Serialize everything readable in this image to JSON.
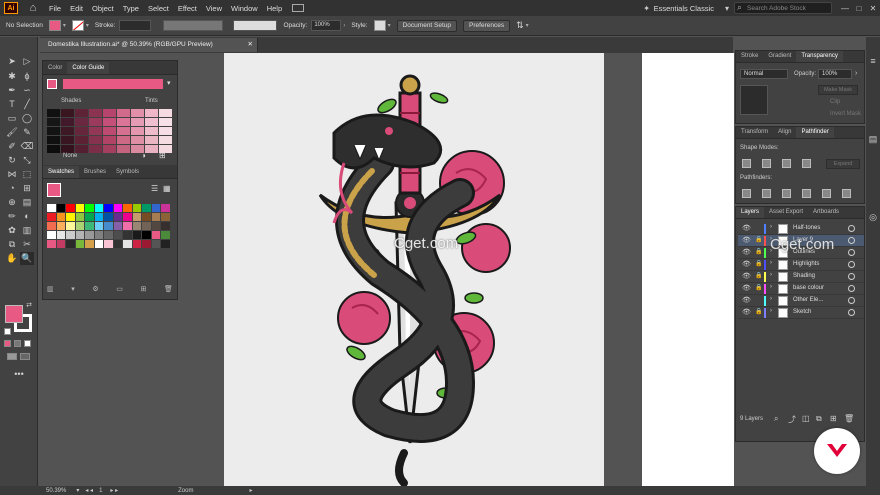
{
  "menu": {
    "app_logo": "Ai",
    "items": [
      "File",
      "Edit",
      "Object",
      "Type",
      "Select",
      "Effect",
      "View",
      "Window",
      "Help"
    ],
    "workspace": "Essentials Classic",
    "search_placeholder": "Search Adobe Stock"
  },
  "control": {
    "selection": "No Selection",
    "stroke_label": "Stroke:",
    "opacity_label": "Opacity:",
    "opacity_value": "100%",
    "style_label": "Style:",
    "doc_setup": "Document Setup",
    "preferences": "Preferences"
  },
  "document": {
    "tab_title": "Domestika Illustration.ai* @ 50.39% (RGB/GPU Preview)"
  },
  "color_guide": {
    "tabs": [
      "Color",
      "Color Guide"
    ],
    "shades_label": "Shades",
    "tints_label": "Tints",
    "none_label": "None",
    "colors": [
      [
        "#111111",
        "#3a1621",
        "#5e2337",
        "#8b3452",
        "#b6446c",
        "#d26a8b",
        "#e290a9",
        "#eeb6c7",
        "#f6dbe3"
      ],
      [
        "#161616",
        "#42192a",
        "#6a2840",
        "#9a3b5d",
        "#c44f78",
        "#db7597",
        "#e69bb4",
        "#f0bfd0",
        "#f8e0e8"
      ],
      [
        "#131313",
        "#3e1825",
        "#66263c",
        "#933757",
        "#bd4a71",
        "#d67090",
        "#e497af",
        "#eebccb",
        "#f7deE6"
      ],
      [
        "#101010",
        "#381520",
        "#5c2234",
        "#86324f",
        "#b04366",
        "#cd6985",
        "#de8fa5",
        "#ebb6c4",
        "#f5dbe2"
      ],
      [
        "#0d0d0d",
        "#33121d",
        "#541f30",
        "#7c2e48",
        "#a53f5f",
        "#c4637e",
        "#d98aa0",
        "#e8b2c0",
        "#f4d9e0"
      ]
    ]
  },
  "swatches": {
    "tabs": [
      "Swatches",
      "Brushes",
      "Symbols"
    ],
    "colors": [
      "#ffffff",
      "#000000",
      "#ff0000",
      "#ffff00",
      "#00ff00",
      "#00ffff",
      "#0000ff",
      "#ff00ff",
      "#ff6600",
      "#99cc00",
      "#009966",
      "#3366cc",
      "#cc3399",
      "#ed1c24",
      "#f7941d",
      "#fff200",
      "#8dc63f",
      "#00a651",
      "#00aeef",
      "#0054a6",
      "#662d91",
      "#ec008c",
      "#c69c6d",
      "#754c24",
      "#a67c52",
      "#8c6239",
      "#f26c4f",
      "#fbaf5d",
      "#fff799",
      "#acd373",
      "#3cb878",
      "#6dcff6",
      "#448ccb",
      "#8560a8",
      "#f06eaa",
      "#998675",
      "#736357",
      "#534741",
      "#362f2d",
      "#ffffff",
      "#e6e6e6",
      "#cccccc",
      "#b3b3b3",
      "#999999",
      "#808080",
      "#666666",
      "#4d4d4d",
      "#333333",
      "#1a1a1a",
      "#000000",
      "#e85a84",
      "#4a8a3a",
      "#e85a84",
      "#c23b62",
      "#2a2a2a",
      "#7ab83c",
      "#d4a04a",
      "#ffffff",
      "#f9c5d5",
      "#333333",
      "#e4e4e4",
      "#cc2244",
      "#9a1a33",
      "#555555",
      "#222222"
    ]
  },
  "right_panels": {
    "stroke_tabs": [
      "Stroke",
      "Gradient",
      "Transparency"
    ],
    "blend_mode": "Normal",
    "opacity_label": "Opacity:",
    "opacity_value": "100%",
    "make_mask": "Make Mask",
    "clip": "Clip",
    "invert_mask": "Invert Mask",
    "transform_tabs": [
      "Transform",
      "Align",
      "Pathfinder"
    ],
    "shape_modes_label": "Shape Modes:",
    "expand": "Expand",
    "pathfinders_label": "Pathfinders:",
    "layers_tabs": [
      "Layers",
      "Asset Export",
      "Artboards"
    ],
    "layers": [
      {
        "name": "Half-tones",
        "color": "#4f7fff",
        "locked": false,
        "selected": false
      },
      {
        "name": "Layer 9",
        "color": "#ff4f4f",
        "locked": true,
        "selected": true
      },
      {
        "name": "Outlines",
        "color": "#4fff4f",
        "locked": true,
        "selected": false
      },
      {
        "name": "Highlights",
        "color": "#4f4fff",
        "locked": true,
        "selected": false
      },
      {
        "name": "Shading",
        "color": "#ffff4f",
        "locked": true,
        "selected": false
      },
      {
        "name": "base colour",
        "color": "#ff4fff",
        "locked": true,
        "selected": false
      },
      {
        "name": "Other Ele...",
        "color": "#4fffff",
        "locked": false,
        "selected": false
      },
      {
        "name": "Sketch",
        "color": "#7f7fff",
        "locked": true,
        "selected": false
      }
    ],
    "layers_count": "9 Layers"
  },
  "status": {
    "zoom": "50.39%",
    "artboard_num": "1",
    "tool_label": "Zoom"
  },
  "watermark": "Cget.com",
  "colors": {
    "fill": "#e85a84",
    "accent_selection": "#4b5a70",
    "domestika_red": "#e2003a"
  }
}
